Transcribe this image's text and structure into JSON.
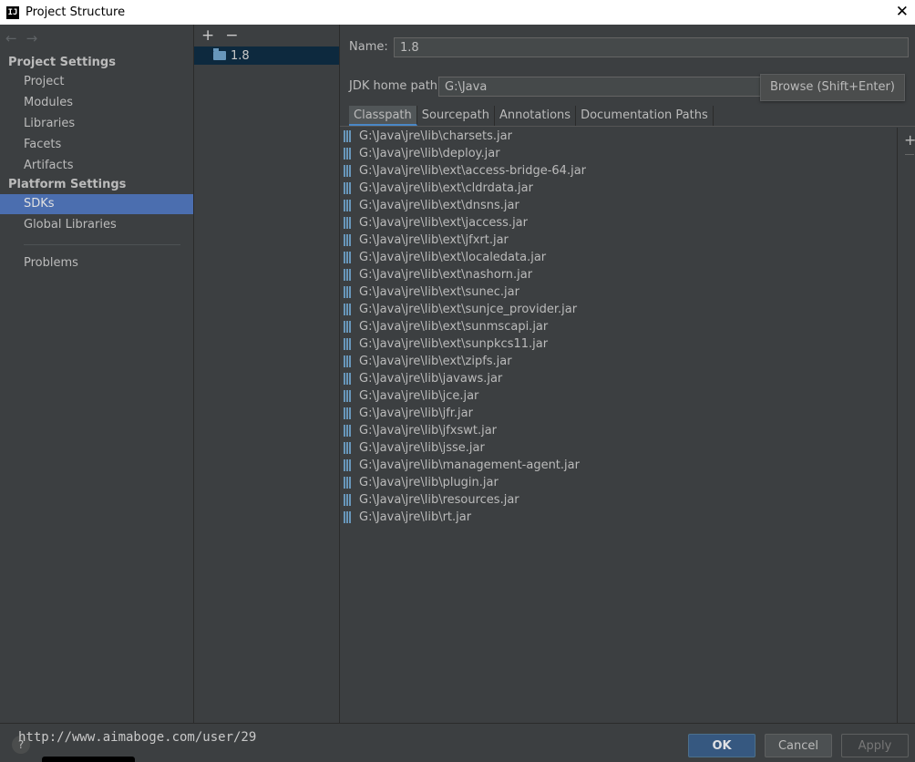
{
  "window": {
    "title": "Project Structure"
  },
  "nav": {
    "project_settings_header": "Project Settings",
    "project_items": [
      "Project",
      "Modules",
      "Libraries",
      "Facets",
      "Artifacts"
    ],
    "platform_settings_header": "Platform Settings",
    "platform_items": [
      "SDKs",
      "Global Libraries"
    ],
    "problems": "Problems",
    "selected": "SDKs"
  },
  "sdk_list": {
    "add": "+",
    "remove": "−",
    "items": [
      "1.8"
    ]
  },
  "details": {
    "name_label": "Name:",
    "name_value": "1.8",
    "jdk_home_label": "JDK home path:",
    "jdk_home_value": "G:\\Java",
    "browse_tooltip": "Browse (Shift+Enter)",
    "tabs": [
      "Classpath",
      "Sourcepath",
      "Annotations",
      "Documentation Paths"
    ],
    "active_tab": "Classpath"
  },
  "classpath": [
    "G:\\Java\\jre\\lib\\charsets.jar",
    "G:\\Java\\jre\\lib\\deploy.jar",
    "G:\\Java\\jre\\lib\\ext\\access-bridge-64.jar",
    "G:\\Java\\jre\\lib\\ext\\cldrdata.jar",
    "G:\\Java\\jre\\lib\\ext\\dnsns.jar",
    "G:\\Java\\jre\\lib\\ext\\jaccess.jar",
    "G:\\Java\\jre\\lib\\ext\\jfxrt.jar",
    "G:\\Java\\jre\\lib\\ext\\localedata.jar",
    "G:\\Java\\jre\\lib\\ext\\nashorn.jar",
    "G:\\Java\\jre\\lib\\ext\\sunec.jar",
    "G:\\Java\\jre\\lib\\ext\\sunjce_provider.jar",
    "G:\\Java\\jre\\lib\\ext\\sunmscapi.jar",
    "G:\\Java\\jre\\lib\\ext\\sunpkcs11.jar",
    "G:\\Java\\jre\\lib\\ext\\zipfs.jar",
    "G:\\Java\\jre\\lib\\javaws.jar",
    "G:\\Java\\jre\\lib\\jce.jar",
    "G:\\Java\\jre\\lib\\jfr.jar",
    "G:\\Java\\jre\\lib\\jfxswt.jar",
    "G:\\Java\\jre\\lib\\jsse.jar",
    "G:\\Java\\jre\\lib\\management-agent.jar",
    "G:\\Java\\jre\\lib\\plugin.jar",
    "G:\\Java\\jre\\lib\\resources.jar",
    "G:\\Java\\jre\\lib\\rt.jar"
  ],
  "buttons": {
    "ok": "OK",
    "cancel": "Cancel",
    "apply": "Apply",
    "help": "?"
  },
  "watermark": "http://www.aimaboge.com/user/29",
  "colors": {
    "selection": "#4b6eaf",
    "background": "#3c3f41",
    "ok_button": "#365880"
  }
}
